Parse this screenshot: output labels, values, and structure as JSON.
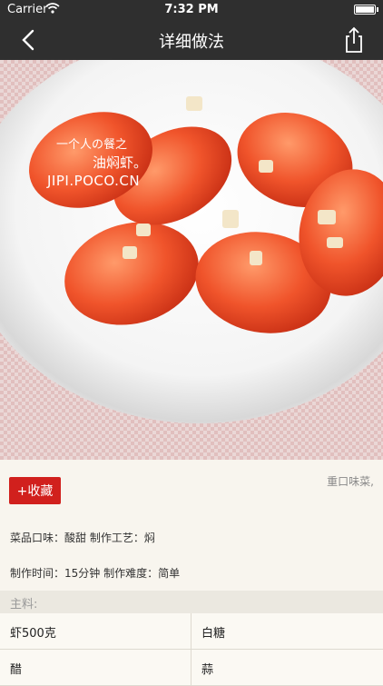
{
  "status_bar": {
    "carrier": "Carrier",
    "time": "7:32 PM"
  },
  "nav": {
    "title": "详细做法",
    "back_icon": "chevron-left-icon",
    "share_icon": "share-icon"
  },
  "hero": {
    "watermark_line1": "一个人の餐之",
    "watermark_line2": "油焖虾。",
    "watermark_line3": "JIPI.POCO.CN"
  },
  "recipe": {
    "favorite_label": "+收藏",
    "tag": "重口味菜,",
    "taste_line": "菜品口味：酸甜 制作工艺：焖",
    "time_line": "制作时间：15分钟 制作难度：简单"
  },
  "ingredients": {
    "heading": "主料:",
    "rows": [
      [
        "虾500克",
        "白糖"
      ],
      [
        "醋",
        "蒜"
      ]
    ]
  },
  "colors": {
    "bar": "#2f2f2f",
    "accent": "#d1201d",
    "background": "#f8f5ee"
  }
}
